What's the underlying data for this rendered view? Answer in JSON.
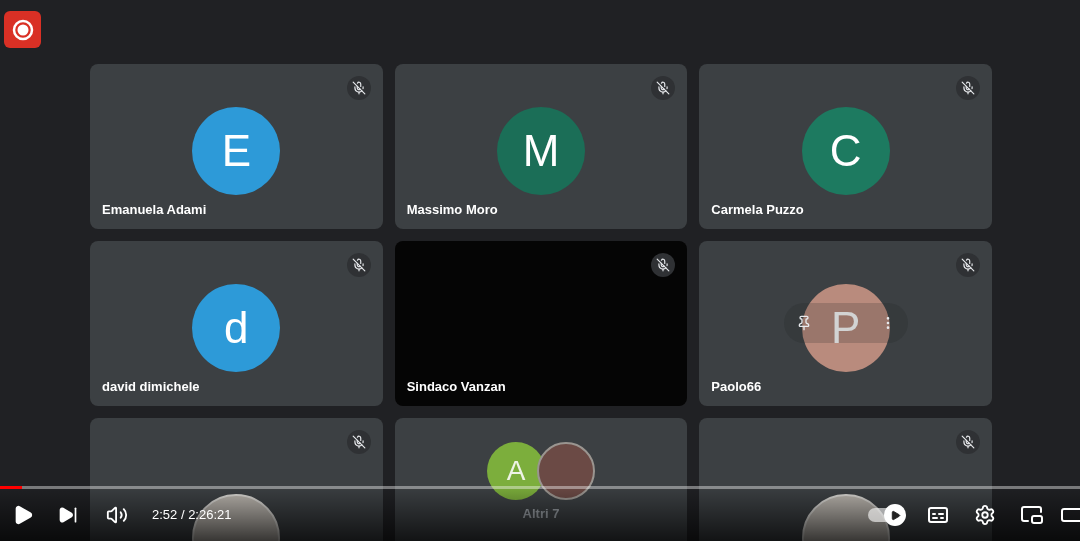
{
  "tiles": [
    {
      "kind": "initial",
      "name": "Emanuela Adami",
      "initial": "E",
      "color": "#2d9ad8",
      "muted": true,
      "hovered": false
    },
    {
      "kind": "initial",
      "name": "Massimo Moro",
      "initial": "M",
      "color": "#1b6e57",
      "muted": true,
      "hovered": false
    },
    {
      "kind": "initial",
      "name": "Carmela Puzzo",
      "initial": "C",
      "color": "#1d7a60",
      "muted": true,
      "hovered": false
    },
    {
      "kind": "initial",
      "name": "david dimichele",
      "initial": "d",
      "color": "#2d9ad8",
      "muted": true,
      "hovered": false
    },
    {
      "kind": "video",
      "name": "Sindaco Vanzan",
      "muted": true,
      "hovered": false
    },
    {
      "kind": "initial",
      "name": "Paolo66",
      "initial": "P",
      "color": "#b98b7d",
      "muted": true,
      "hovered": true
    },
    {
      "kind": "photo",
      "muted": true,
      "hovered": false
    },
    {
      "kind": "group",
      "name": "Altri 7",
      "initial": "A",
      "color": "#7cae3c",
      "muted": false,
      "hovered": false
    },
    {
      "kind": "photo",
      "muted": true,
      "hovered": false
    }
  ],
  "player": {
    "time": "2:52 / 2:26:21",
    "level": 0.02,
    "autoplay_on": true
  }
}
